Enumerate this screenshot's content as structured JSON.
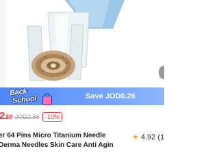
{
  "hero": {
    "image": "derma-roller-image"
  },
  "promo": {
    "line1": "Back",
    "line2": "School",
    "badge_icon": "backpack-icon",
    "save_text": "Save JOD0.26"
  },
  "price": {
    "main": "2.",
    "decimal": "30",
    "old": "JOD2.56",
    "discount": "-10%"
  },
  "product": {
    "title_line1": "er 64 Pins Micro Titanium Needle",
    "title_line2": " Derma Needles Skin Care Anti Agin",
    "rating": "4.92 (1"
  },
  "colors": {
    "accent_red": "#ff2a35",
    "promo_blue": "#4f86f7",
    "star": "#f2b01e"
  }
}
